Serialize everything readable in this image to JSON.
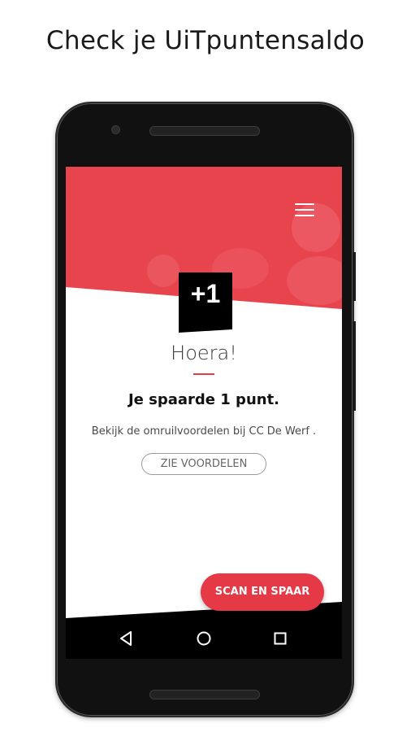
{
  "promo": {
    "title": "Check je UiTpuntensaldo"
  },
  "app": {
    "menu_icon": "hamburger-menu-icon",
    "badge_text": "+1",
    "heading": "Hoera!",
    "saved_message": "Je spaarde 1 punt.",
    "info_text": "Bekijk de omruilvoordelen bij CC De Werf .",
    "view_benefits_button": "ZIE VOORDELEN",
    "scan_button": "SCAN EN SPAAR"
  },
  "navbar": {
    "back_icon": "back-triangle-icon",
    "home_icon": "home-circle-icon",
    "recents_icon": "recents-square-icon"
  },
  "colors": {
    "accent": "#e63946",
    "dark": "#000000",
    "text": "#3a3a3a"
  }
}
